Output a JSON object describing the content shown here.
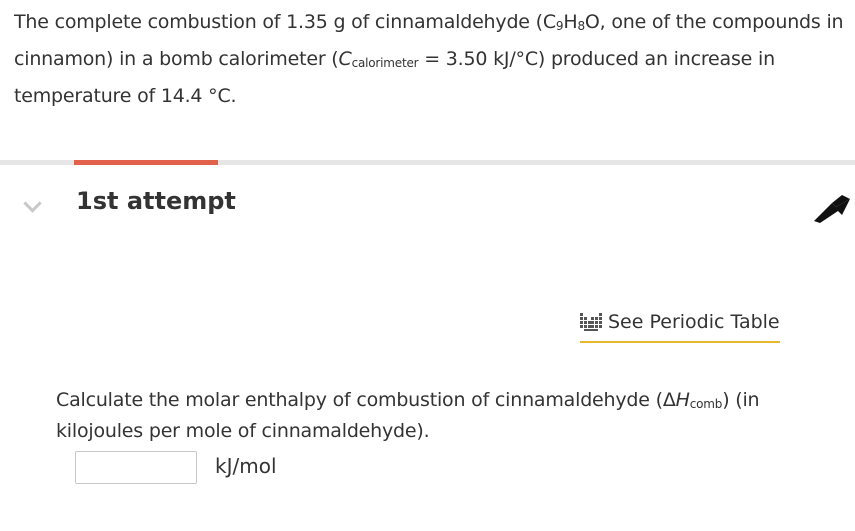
{
  "problem": {
    "text_part1": "The complete combustion of  1.35 g of cinnamaldehyde (C",
    "sub_c": "9",
    "text_h": "H",
    "sub_h": "8",
    "text_part2": "O, one of the compounds in cinnamon) in a bomb calorimeter (",
    "c_symbol": "C",
    "c_subscript": "calorimeter",
    "text_part3": " = 3.50 kJ/°C) produced an increase in temperature of  14.4 °C."
  },
  "attempt": {
    "title": "1st attempt"
  },
  "periodic_table": {
    "label": "See Periodic Table"
  },
  "question": {
    "text_part1": "Calculate the molar enthalpy of combustion of cinnamaldehyde (",
    "delta": "Δ",
    "h_symbol": "H",
    "h_subscript": "comb",
    "text_part2": ") (in kilojoules per mole of cinnamaldehyde)."
  },
  "answer": {
    "value": "",
    "unit": "kJ/mol"
  },
  "colors": {
    "accent_tab": "#e2614a",
    "periodic_underline": "#e6b830"
  },
  "icons": {
    "chevron": "chevron-down-icon",
    "flag": "flag-icon",
    "periodic": "periodic-table-icon"
  }
}
